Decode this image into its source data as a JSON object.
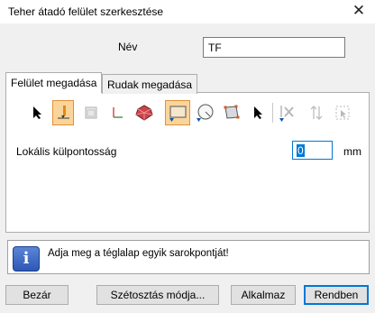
{
  "window": {
    "title": "Teher átadó felület szerkesztése"
  },
  "name": {
    "label": "Név",
    "value": "TF"
  },
  "tabs": [
    {
      "label": "Felület megadása",
      "active": true
    },
    {
      "label": "Rudak megadása",
      "active": false
    }
  ],
  "toolbar": {
    "tools": [
      {
        "icon": "arrow-pointer-icon",
        "selected": false
      },
      {
        "icon": "plane-edge-icon",
        "selected": true
      },
      {
        "icon": "frame-disabled-icon",
        "selected": false
      },
      {
        "icon": "axis-angle-icon",
        "selected": false
      },
      {
        "icon": "polyhedron-icon",
        "selected": false
      },
      {
        "icon": "rectangle-icon",
        "selected": true
      },
      {
        "icon": "circle-icon",
        "selected": false
      },
      {
        "icon": "polygon-icon",
        "selected": false
      },
      {
        "icon": "arrow-pointer-icon",
        "selected": false
      },
      {
        "icon": "delete-disabled-icon",
        "selected": false
      },
      {
        "icon": "flip-disabled-icon",
        "selected": false
      },
      {
        "icon": "select-region-disabled-icon",
        "selected": false
      }
    ]
  },
  "eccentricity": {
    "label": "Lokális külpontosság",
    "value": "0",
    "unit": "mm"
  },
  "message": {
    "text": "Adja meg a téglalap egyik sarokpontját!"
  },
  "buttons": {
    "close": "Bezár",
    "distribution": "Szétosztás módja...",
    "apply": "Alkalmaz",
    "ok": "Rendben"
  },
  "colors": {
    "accent": "#0078d7",
    "selected_tool": "#fbd49a",
    "info_icon": "#2d57b6"
  }
}
